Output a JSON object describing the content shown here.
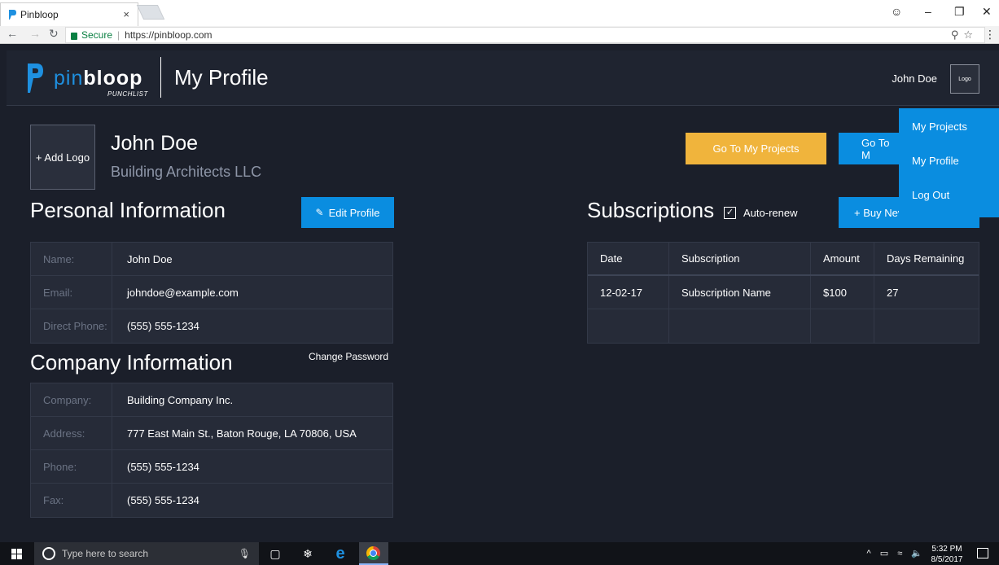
{
  "browser": {
    "tab_title": "Pinbloop",
    "tab_close": "×",
    "secure_label": "Secure",
    "url": "https://pinbloop.com"
  },
  "header": {
    "logo_pin": "pin",
    "logo_bloop": "bloop",
    "logo_sub": "PUNCHLIST",
    "page_title": "My Profile",
    "user_name": "John Doe",
    "user_logo": "Logo"
  },
  "profile": {
    "add_logo": "+ Add Logo",
    "name": "John Doe",
    "company": "Building Architects LLC"
  },
  "personal": {
    "title": "Personal Information",
    "edit_button": "Edit Profile",
    "rows": [
      {
        "label": "Name:",
        "value": "John Doe"
      },
      {
        "label": "Email:",
        "value": "johndoe@example.com"
      },
      {
        "label": "Direct Phone:",
        "value": "(555) 555-1234"
      }
    ]
  },
  "company": {
    "title": "Company Information",
    "change_password": "Change Password",
    "rows": [
      {
        "label": "Company:",
        "value": "Building Company Inc."
      },
      {
        "label": "Address:",
        "value": "777 East Main St., Baton Rouge, LA 70806, USA"
      },
      {
        "label": "Phone:",
        "value": "(555) 555-1234"
      },
      {
        "label": "Fax:",
        "value": "(555) 555-1234"
      }
    ]
  },
  "actions": {
    "go_projects": "Go To My Projects",
    "go_m": "Go To M",
    "buy_new": "+ Buy Nev"
  },
  "subscriptions": {
    "title": "Subscriptions",
    "auto_renew": "Auto-renew",
    "auto_renew_checked": true,
    "columns": [
      "Date",
      "Subscription",
      "Amount",
      "Days Remaining"
    ],
    "rows": [
      [
        "12-02-17",
        "Subscription Name",
        "$100",
        "27"
      ],
      [
        "",
        "",
        "",
        ""
      ]
    ]
  },
  "dropdown": {
    "items": [
      "My Projects",
      "My Profile",
      "Log Out"
    ]
  },
  "taskbar": {
    "search_placeholder": "Type here to search",
    "time": "5:32 PM",
    "date": "8/5/2017"
  },
  "colors": {
    "accent_blue": "#0a8de0",
    "accent_yellow": "#f0b43c",
    "background": "#1b1f2a"
  }
}
